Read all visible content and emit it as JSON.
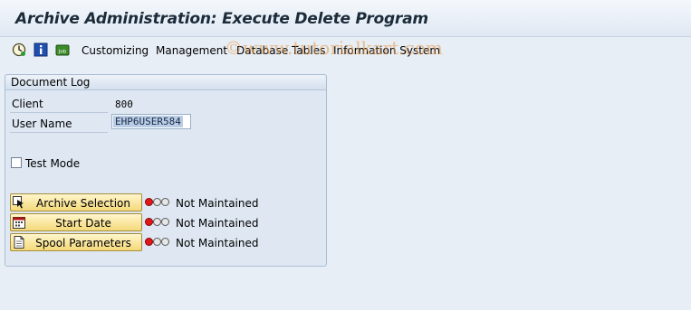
{
  "window": {
    "title": "Archive Administration: Execute Delete Program"
  },
  "toolbar": {
    "icons": [
      "execute-clock-icon",
      "info-icon",
      "job-icon"
    ],
    "menu": [
      "Customizing",
      "Management",
      "Database Tables",
      "Information System"
    ]
  },
  "watermark": "©www.tutorialkart.com",
  "panel": {
    "title": "Document Log",
    "client_label": "Client",
    "client_value": "800",
    "user_label": "User Name",
    "user_value": "EHP6USER584",
    "test_mode_label": "Test Mode",
    "test_mode_checked": false,
    "actions": [
      {
        "label": "Archive Selection",
        "icon": "selection-cursor-icon",
        "status": "Not Maintained",
        "light": "red"
      },
      {
        "label": "Start Date",
        "icon": "calendar-icon",
        "status": "Not Maintained",
        "light": "red"
      },
      {
        "label": "Spool Parameters",
        "icon": "document-icon",
        "status": "Not Maintained",
        "light": "red"
      }
    ]
  },
  "colors": {
    "status_red": "#e01818",
    "button_yellow": "#f4d97a",
    "title_color": "#1c2b3a"
  }
}
